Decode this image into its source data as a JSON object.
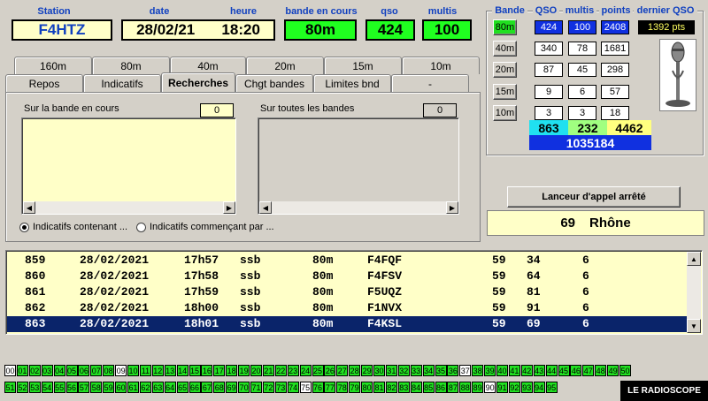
{
  "header": {
    "station_label": "Station",
    "date_label": "date",
    "heure_label": "heure",
    "bande_label": "bande en cours",
    "qso_label": "qso",
    "multis_label": "multis",
    "station": "F4HTZ",
    "date": "28/02/21",
    "heure": "18:20",
    "bande": "80m",
    "qso": "424",
    "multis": "100"
  },
  "band_table": {
    "col_bande": "Bande",
    "col_qso": "QSO",
    "col_multis": "multis",
    "col_points": "points",
    "col_dernier": "dernier QSO",
    "dernier_pts": "1392 pts",
    "rows": [
      {
        "band": "80m",
        "qso": "424",
        "multis": "100",
        "points": "2408"
      },
      {
        "band": "40m",
        "qso": "340",
        "multis": "78",
        "points": "1681"
      },
      {
        "band": "20m",
        "qso": "87",
        "multis": "45",
        "points": "298"
      },
      {
        "band": "15m",
        "qso": "9",
        "multis": "6",
        "points": "57"
      },
      {
        "band": "10m",
        "qso": "3",
        "multis": "3",
        "points": "18"
      }
    ],
    "total_qso": "863",
    "total_multis": "232",
    "total_points": "4462",
    "score": "1035184"
  },
  "tabs_bands": [
    "160m",
    "80m",
    "40m",
    "20m",
    "15m",
    "10m"
  ],
  "tabs_main": [
    "Repos",
    "Indicatifs",
    "Recherches",
    "Chgt bandes",
    "Limites bnd",
    "-"
  ],
  "search": {
    "current_label": "Sur la bande en cours",
    "current_count": "0",
    "all_label": "Sur toutes les bandes",
    "all_count": "0",
    "radio1": "Indicatifs contenant ...",
    "radio2": "Indicatifs commençant par ..."
  },
  "caller_button": "Lanceur d'appel arrêté",
  "department": {
    "num": "69",
    "name": "Rhône"
  },
  "log": [
    {
      "n": "859",
      "date": "28/02/2021",
      "time": "17h57",
      "mode": "ssb",
      "band": "80m",
      "call": "F4FQF",
      "rst": "59",
      "serial": "34",
      "x": "6"
    },
    {
      "n": "860",
      "date": "28/02/2021",
      "time": "17h58",
      "mode": "ssb",
      "band": "80m",
      "call": "F4FSV",
      "rst": "59",
      "serial": "64",
      "x": "6"
    },
    {
      "n": "861",
      "date": "28/02/2021",
      "time": "17h59",
      "mode": "ssb",
      "band": "80m",
      "call": "F5UQZ",
      "rst": "59",
      "serial": "81",
      "x": "6"
    },
    {
      "n": "862",
      "date": "28/02/2021",
      "time": "18h00",
      "mode": "ssb",
      "band": "80m",
      "call": "F1NVX",
      "rst": "59",
      "serial": "91",
      "x": "6"
    },
    {
      "n": "863",
      "date": "28/02/2021",
      "time": "18h01",
      "mode": "ssb",
      "band": "80m",
      "call": "F4KSL",
      "rst": "59",
      "serial": "69",
      "x": "6"
    }
  ],
  "dept_grid": {
    "row1": [
      "00",
      "01",
      "02",
      "03",
      "04",
      "05",
      "06",
      "07",
      "08",
      "09",
      "10",
      "11",
      "12",
      "13",
      "14",
      "15",
      "16",
      "17",
      "18",
      "19",
      "20",
      "21",
      "22",
      "23",
      "24",
      "25",
      "26",
      "27",
      "28",
      "29",
      "30",
      "31",
      "32",
      "33",
      "34",
      "35",
      "36",
      "37",
      "38",
      "39",
      "40",
      "41",
      "42",
      "43",
      "44",
      "45",
      "46",
      "47",
      "48",
      "49",
      "50"
    ],
    "row2": [
      "51",
      "52",
      "53",
      "54",
      "55",
      "56",
      "57",
      "58",
      "59",
      "60",
      "61",
      "62",
      "63",
      "64",
      "65",
      "66",
      "67",
      "68",
      "69",
      "70",
      "71",
      "72",
      "73",
      "74",
      "75",
      "76",
      "77",
      "78",
      "79",
      "80",
      "81",
      "82",
      "83",
      "84",
      "85",
      "86",
      "87",
      "88",
      "89",
      "90",
      "91",
      "92",
      "93",
      "94",
      "95"
    ],
    "white": [
      "00",
      "09",
      "37",
      "75",
      "90"
    ]
  },
  "brand": "LE RADIOSCOPE"
}
